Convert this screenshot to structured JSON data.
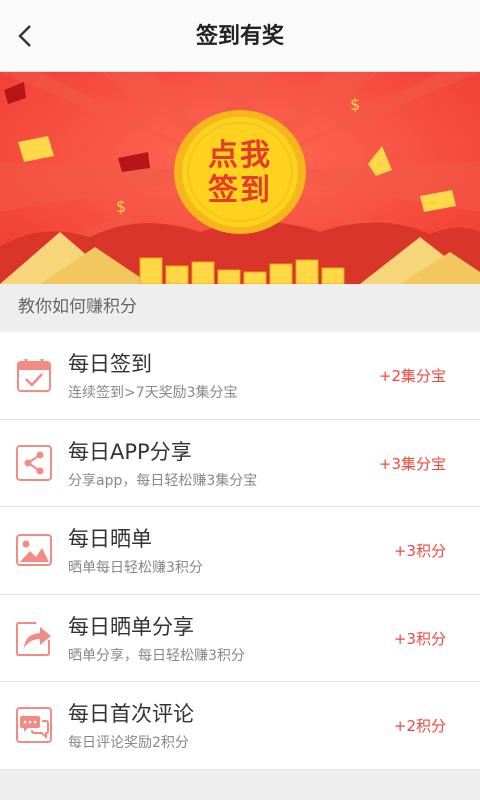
{
  "header": {
    "title": "签到有奖",
    "back_icon": "chevron-left-icon"
  },
  "banner": {
    "button_text_line1": "点我",
    "button_text_line2": "签到",
    "colors": {
      "bg": "#f0483d",
      "coin": "#ffd21f",
      "text": "#e53b2b"
    }
  },
  "section": {
    "title": "教你如何赚积分"
  },
  "tasks": [
    {
      "name": "每日签到",
      "desc": "连续签到>7天奖励3集分宝",
      "reward": "+2集分宝",
      "icon": "calendar-check-icon"
    },
    {
      "name": "每日APP分享",
      "desc": "分享app，每日轻松赚3集分宝",
      "reward": "+3集分宝",
      "icon": "share-icon"
    },
    {
      "name": "每日晒单",
      "desc": "晒单每日轻松赚3积分",
      "reward": "+3积分",
      "icon": "image-icon"
    },
    {
      "name": "每日晒单分享",
      "desc": "晒单分享，每日轻松赚3积分",
      "reward": "+3积分",
      "icon": "forward-arrow-icon"
    },
    {
      "name": "每日首次评论",
      "desc": "每日评论奖励2积分",
      "reward": "+2积分",
      "icon": "comment-icon"
    }
  ]
}
